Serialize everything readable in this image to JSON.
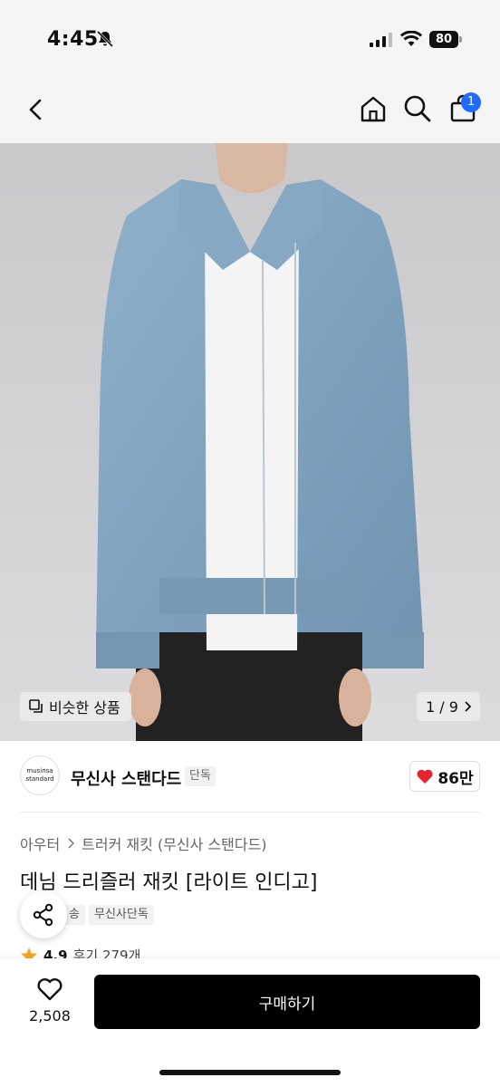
{
  "status_bar": {
    "time": "4:45",
    "battery": "80"
  },
  "nav": {
    "cart_count": "1"
  },
  "image": {
    "similar_label": "비슷한 상품",
    "pager": "1 / 9"
  },
  "brand": {
    "logo_line1": "musinsa",
    "logo_line2": "standard",
    "name": "무신사 스탠다드",
    "tag": "단독",
    "likes": "86만"
  },
  "product": {
    "category": [
      "아우터",
      "트러커 재킷 (무신사 스탠다드)"
    ],
    "title": "데님 드리즐러 재킷 [라이트 인디고]",
    "tags": [
      "송",
      "무신사단독"
    ],
    "rating": "4.9",
    "reviews": "후기 279개"
  },
  "bottom": {
    "wish_count": "2,508",
    "buy_label": "구매하기"
  },
  "colors": {
    "accent": "#1f6bff",
    "heart": "#e8232e",
    "star": "#f5a623",
    "buy_bg": "#000000"
  }
}
